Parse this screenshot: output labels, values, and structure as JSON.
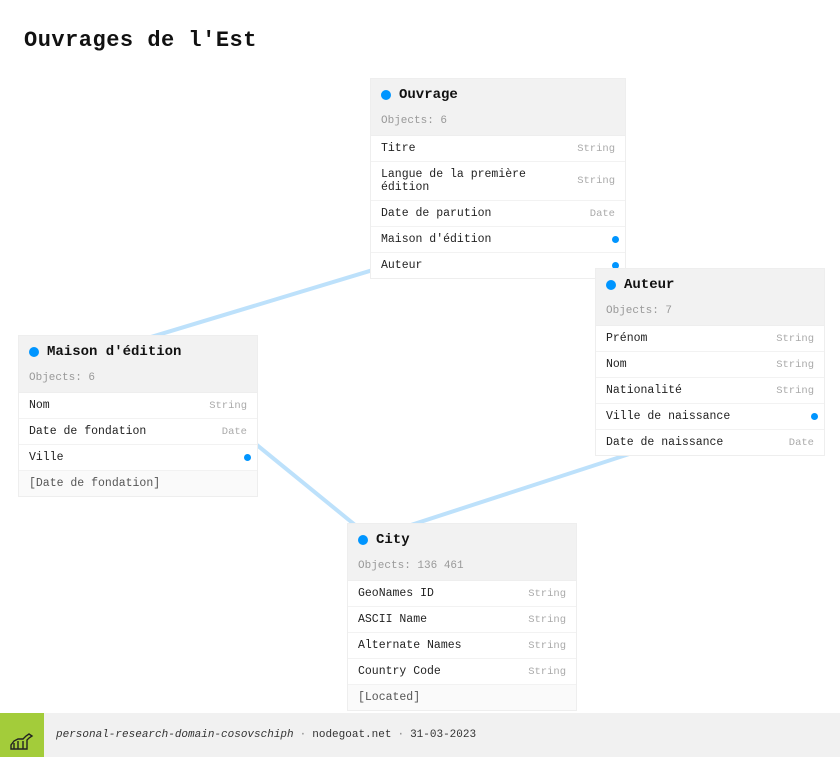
{
  "title": "Ouvrages de l'Est",
  "nodes": {
    "ouvrage": {
      "title": "Ouvrage",
      "objects": "Objects: 6",
      "rows": [
        {
          "label": "Titre",
          "type": "String"
        },
        {
          "label": "Langue de la première édition",
          "type": "String"
        },
        {
          "label": "Date de parution",
          "type": "Date"
        },
        {
          "label": "Maison d'édition",
          "link": true
        },
        {
          "label": "Auteur",
          "link": true
        }
      ]
    },
    "maison": {
      "title": "Maison d'édition",
      "objects": "Objects: 6",
      "rows": [
        {
          "label": "Nom",
          "type": "String"
        },
        {
          "label": "Date de fondation",
          "type": "Date"
        },
        {
          "label": "Ville",
          "link": true
        },
        {
          "label": "[Date de fondation]",
          "sub": true
        }
      ]
    },
    "auteur": {
      "title": "Auteur",
      "objects": "Objects: 7",
      "rows": [
        {
          "label": "Prénom",
          "type": "String"
        },
        {
          "label": "Nom",
          "type": "String"
        },
        {
          "label": "Nationalité",
          "type": "String"
        },
        {
          "label": "Ville de naissance",
          "link": true
        },
        {
          "label": "Date de naissance",
          "type": "Date"
        }
      ]
    },
    "city": {
      "title": "City",
      "objects": "Objects: 136 461",
      "rows": [
        {
          "label": "GeoNames ID",
          "type": "String"
        },
        {
          "label": "ASCII Name",
          "type": "String"
        },
        {
          "label": "Alternate Names",
          "type": "String"
        },
        {
          "label": "Country Code",
          "type": "String"
        },
        {
          "label": "[Located]",
          "sub": true
        }
      ]
    }
  },
  "footer": {
    "domain": "personal-research-domain-cosovschiph",
    "site": "nodegoat.net",
    "date": "31-03-2023"
  },
  "colors": {
    "accent": "#0095ff",
    "footerLogo": "#a3cc3a"
  }
}
